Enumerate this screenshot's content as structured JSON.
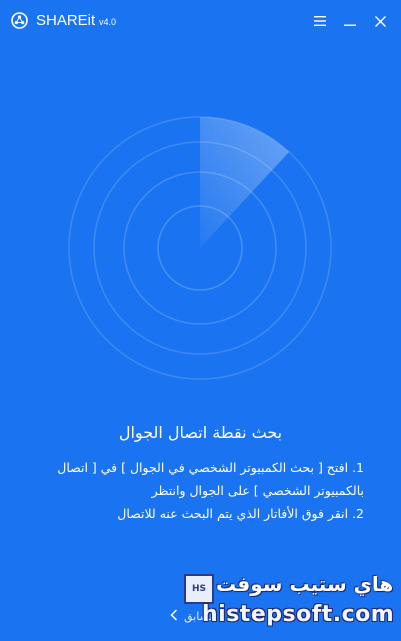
{
  "window": {
    "app_name": "SHAREit",
    "version": "v4.0",
    "icons": {
      "logo": "shareit-logo-icon",
      "menu": "hamburger-menu-icon",
      "minimize": "minimize-icon",
      "close": "close-icon"
    }
  },
  "main": {
    "heading": "بحث نقطة اتصال الجوال",
    "instructions": [
      "1. افتح [ بحث الكمبيوتر الشخصي في الجوال ] في [ اتصال",
      "بالكمبيوتر الشخصي ] على الجوال وانتظر",
      "2. انقر فوق الأفاتار الذي يتم البحث عنه للاتصال"
    ],
    "back_label": "السابق"
  },
  "watermark": {
    "box_text": "HS",
    "arabic": "هاي ستيب سوفت",
    "latin": "histepsoft.com"
  },
  "colors": {
    "background": "#1a73f0",
    "text": "#ffffff"
  }
}
